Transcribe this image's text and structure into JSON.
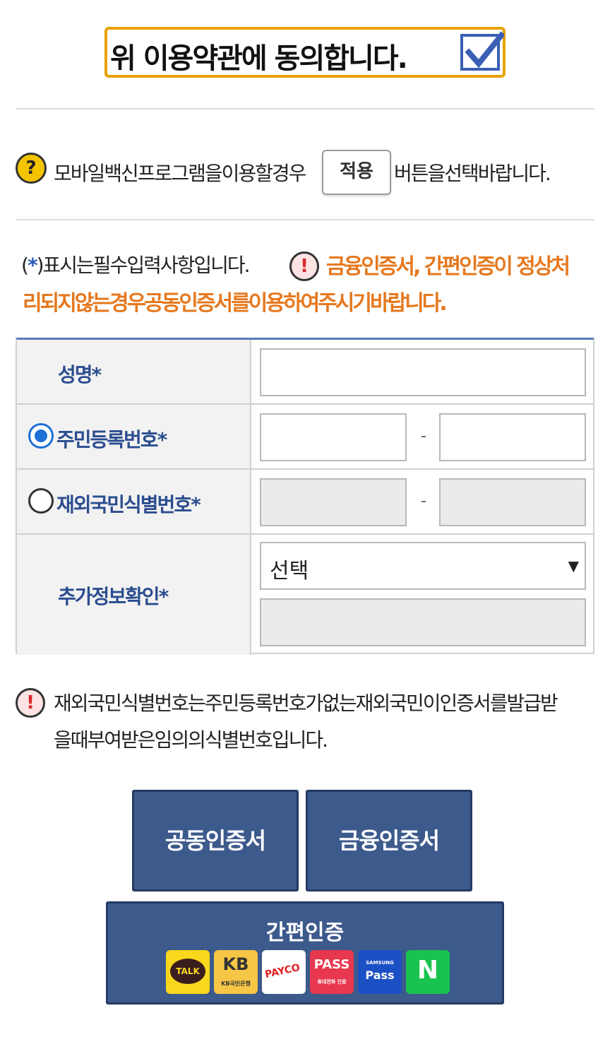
{
  "agreement": {
    "text": "위 이용약관에 동의합니다.",
    "checked": true
  },
  "vaccine_notice": {
    "before": "모바일백신프로그램을이용할경우",
    "button_label": "적용",
    "after": "버튼을선택바랍니다."
  },
  "required_note": {
    "open": "(",
    "star": "*",
    "close": ")표시는필수입력사항입니다."
  },
  "warning_note": {
    "line1": "금융인증서, 간편인증이 정상처",
    "line2": "리되지않는경우공동인증서를이용하여주시기바랍니다."
  },
  "form": {
    "name_label": "성명",
    "resident_label": "주민등록번호",
    "foreign_label": "재외국민식별번호",
    "extra_label": "추가정보확인",
    "required_star": "*",
    "dash": "-",
    "select_value": "선택",
    "select_arrow": "▼",
    "selected_id_type": "resident"
  },
  "foreign_note": {
    "line1": "재외국민식별번호는주민등록번호가없는재외국민이인증서를발급받",
    "line2": "을때부여받은임의의식별번호입니다."
  },
  "buttons": {
    "joint_cert": "공동인증서",
    "financial_cert": "금융인증서",
    "simple_auth": "간편인증"
  },
  "simple_auth_logos": {
    "kakao": "TALK",
    "kb_mark": "KB",
    "kb_sub": "KB국민은행",
    "payco": "PAYCO",
    "pass": "PASS",
    "pass_sub": "휴대전화 인증",
    "samsung_top": "SAMSUNG",
    "samsung_pass": "Pass",
    "naver": "N"
  },
  "colors": {
    "agree_border": "#e8a300",
    "checkbox": "#3a5fb5",
    "label_blue": "#2b4d8f",
    "warning_orange": "#e6781e",
    "button_blue": "#3d5a8c",
    "radio_selected": "#1f6fd8"
  },
  "icons": {
    "help": "?",
    "warning": "!"
  }
}
